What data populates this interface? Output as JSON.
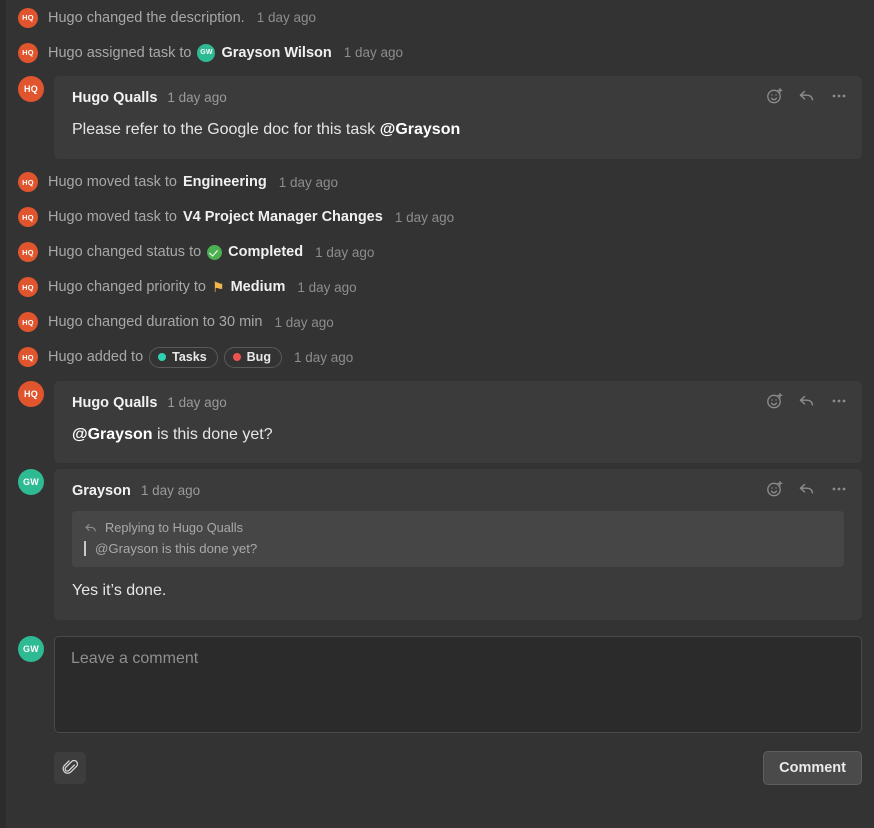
{
  "colors": {
    "page_bg": "#333333",
    "card_bg": "#3b3b3b",
    "quote_bg": "#464646",
    "avatar_hugo": "#e0552d",
    "avatar_grayson": "#2eba92",
    "status_completed": "#4caf50",
    "priority_medium": "#f0b64b",
    "tag_tasks_dot": "#2dd4b4",
    "tag_bug_dot": "#ef5350"
  },
  "avatars": {
    "hugo_initials": "HQ",
    "grayson_initials": "GW"
  },
  "activity": [
    {
      "avatar": "HQ",
      "prefix": "Hugo changed the description.",
      "value": "",
      "time": "1 day ago"
    },
    {
      "avatar": "HQ",
      "prefix": "Hugo assigned task to",
      "value": "Grayson Wilson",
      "time": "1 day ago",
      "inline_avatar": "GW"
    },
    {
      "avatar": "HQ",
      "prefix": "Hugo moved task to",
      "value": "Engineering",
      "time": "1 day ago"
    },
    {
      "avatar": "HQ",
      "prefix": "Hugo moved task to",
      "value": "V4 Project Manager Changes",
      "time": "1 day ago"
    },
    {
      "avatar": "HQ",
      "prefix": "Hugo changed status to",
      "value": "Completed",
      "time": "1 day ago",
      "icon": "status-completed-icon"
    },
    {
      "avatar": "HQ",
      "prefix": "Hugo changed priority to",
      "value": "Medium",
      "time": "1 day ago",
      "icon": "flag-icon"
    },
    {
      "avatar": "HQ",
      "prefix": "Hugo changed duration to 30 min",
      "value": "",
      "time": "1 day ago"
    },
    {
      "avatar": "HQ",
      "prefix": "Hugo added to",
      "value": "",
      "time": "1 day ago",
      "tags": [
        {
          "label": "Tasks",
          "dot": "#2dd4b4"
        },
        {
          "label": "Bug",
          "dot": "#ef5350"
        }
      ]
    }
  ],
  "comments": [
    {
      "avatar": "HQ",
      "avatar_type": "hq",
      "author": "Hugo Qualls",
      "time": "1 day ago",
      "body_pre": "Please refer to the Google doc for this task ",
      "body_mention": "@Grayson",
      "body_post": ""
    },
    {
      "avatar": "HQ",
      "avatar_type": "hq",
      "author": "Hugo Qualls",
      "time": "1 day ago",
      "body_pre": "",
      "body_mention": "@Grayson",
      "body_post": " is this done yet?"
    },
    {
      "avatar": "GW",
      "avatar_type": "gw",
      "author": "Grayson",
      "time": "1 day ago",
      "quote_label": "Replying to Hugo Qualls",
      "quote_text": "@Grayson is this done yet?",
      "body_pre": "Yes it’s done.",
      "body_mention": "",
      "body_post": ""
    }
  ],
  "card_actions": {
    "react_icon": "add-reaction-icon",
    "reply_icon": "reply-icon",
    "more_icon": "more-options-icon"
  },
  "composer": {
    "avatar": "GW",
    "placeholder": "Leave a comment",
    "value": "",
    "attach_icon": "paperclip-icon",
    "submit_label": "Comment"
  }
}
